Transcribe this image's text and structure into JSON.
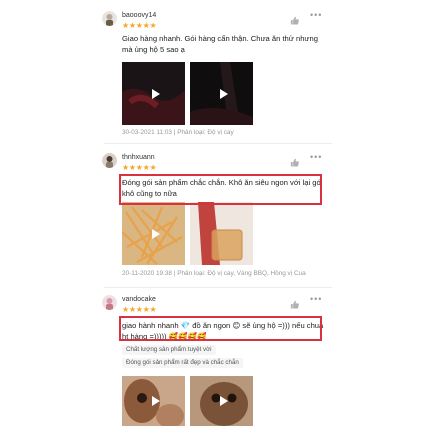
{
  "reviews": [
    {
      "username": "baooovy14",
      "stars": "★★★★★",
      "text": "Giao hàng nhanh. Gói hàng cẩn thận. Chưa ăn thử nhưng mà ủng hộ 5 sao ạ",
      "meta": "30-03-2021 11:03 | Phân loại: Độ vị cay"
    },
    {
      "username": "thnhxuann",
      "stars": "★★★★★",
      "text": "Đóng gói sản phẩm chắc chắn. Khô ăn siêu ngon với lại gói khô cũng to nữa",
      "meta": "20-11-2020 19:38 | Phân loại: Độ vị cay, Vàng BBQ, Hồng vị Cua"
    },
    {
      "username": "vandocake",
      "stars": "★★★★★",
      "text": "giao hành nhanh 💎 đồ ăn ngon 😊 sẽ ủng hộ =))) nếu chua ht hàng =))))) 🥰🥰🥰🥰",
      "tags": [
        "Chất lượng sản phẩm tuyệt vời",
        "Đóng gói sản phẩm rất đẹp và chắc chắn"
      ]
    }
  ],
  "colors": {
    "star": "#f5a623",
    "highlight_border": "#d8313f"
  },
  "icons": {
    "like": "thumbs-up-icon",
    "more": "more-dots-icon",
    "play": "play-icon"
  }
}
